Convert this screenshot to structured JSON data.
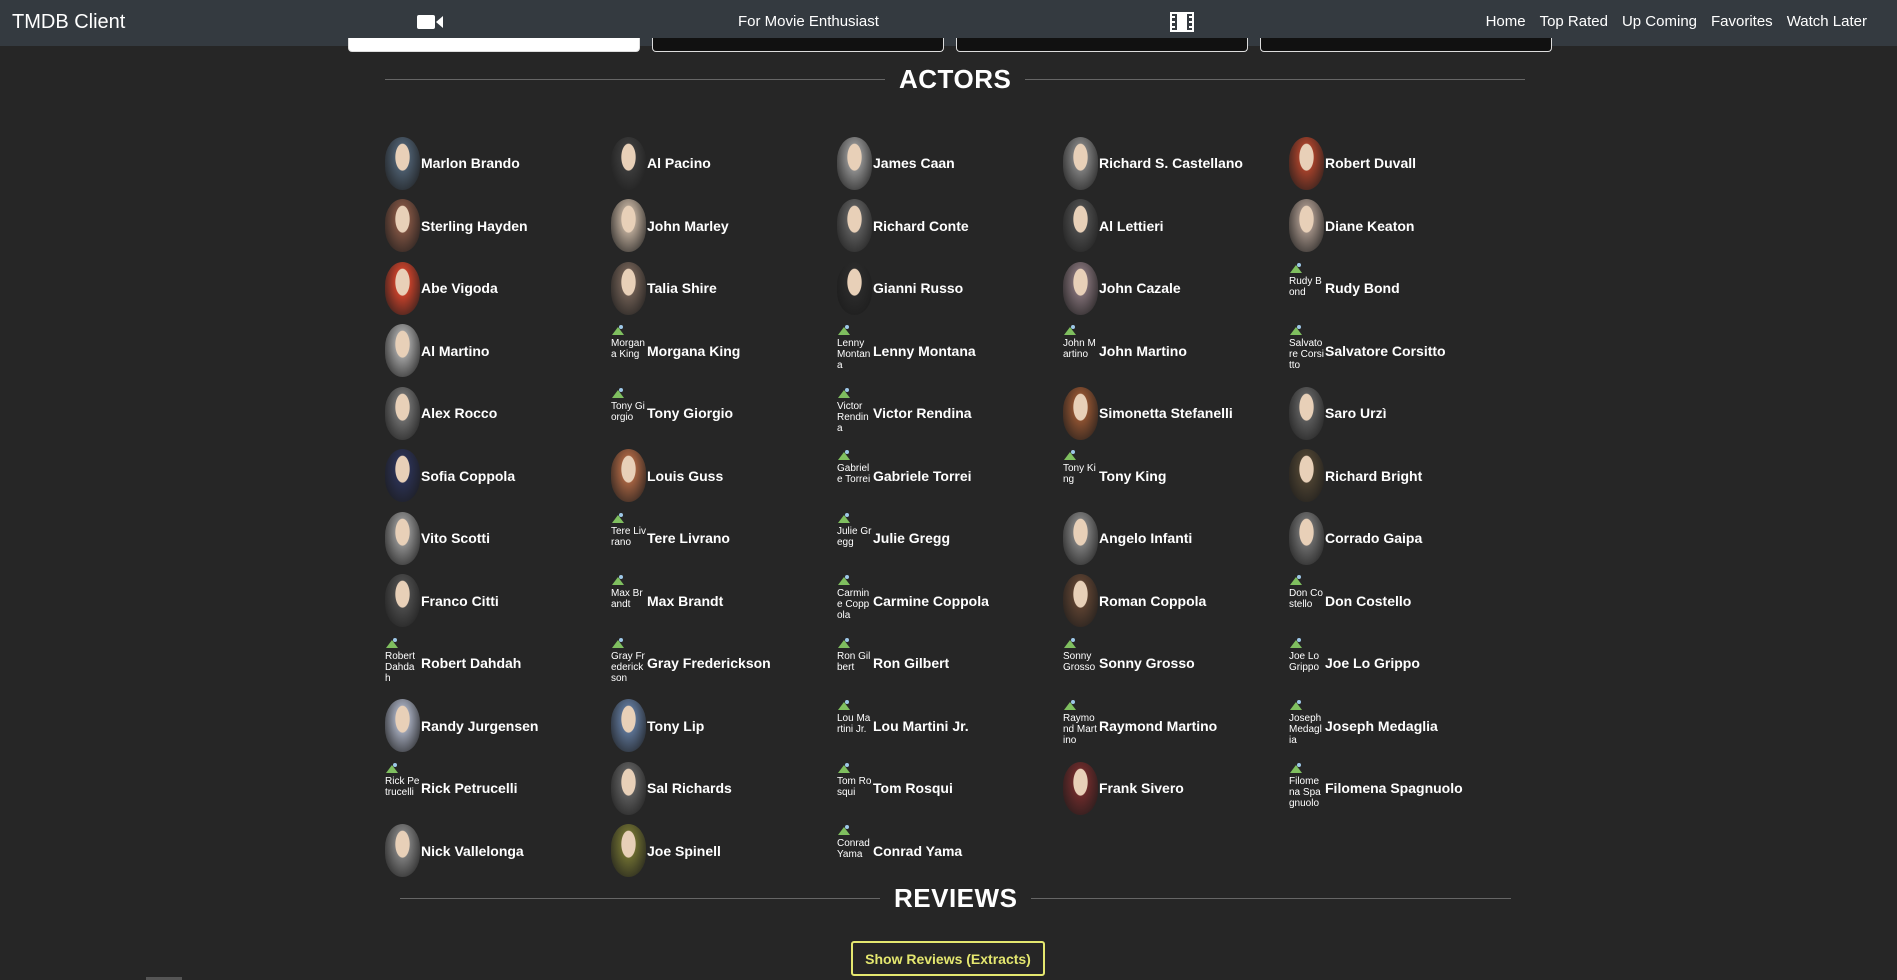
{
  "navbar": {
    "brand": "TMDB Client",
    "tagline": "For Movie Enthusiast",
    "camera_icon": "video-camera-icon",
    "film_icon": "film-icon",
    "links": [
      "Home",
      "Top Rated",
      "Up Coming",
      "Favorites",
      "Watch Later"
    ]
  },
  "actors_section": {
    "title": "ACTORS",
    "actors": [
      {
        "name": "Marlon Brando",
        "photo": true,
        "color": "#4a5a6a"
      },
      {
        "name": "Al Pacino",
        "photo": true,
        "color": "#3a3a3a"
      },
      {
        "name": "James Caan",
        "photo": true,
        "color": "#8a8a8a"
      },
      {
        "name": "Richard S. Castellano",
        "photo": true,
        "color": "#7a7a7a"
      },
      {
        "name": "Robert Duvall",
        "photo": true,
        "color": "#a0402a"
      },
      {
        "name": "Sterling Hayden",
        "photo": true,
        "color": "#7a5040"
      },
      {
        "name": "John Marley",
        "photo": true,
        "color": "#b0a090"
      },
      {
        "name": "Richard Conte",
        "photo": true,
        "color": "#5a5a5a"
      },
      {
        "name": "Al Lettieri",
        "photo": true,
        "color": "#4a4a4a"
      },
      {
        "name": "Diane Keaton",
        "photo": true,
        "color": "#9a8a80"
      },
      {
        "name": "Abe Vigoda",
        "photo": true,
        "color": "#c0402a"
      },
      {
        "name": "Talia Shire",
        "photo": true,
        "color": "#6a5a50"
      },
      {
        "name": "Gianni Russo",
        "photo": true,
        "color": "#2a2a2a"
      },
      {
        "name": "John Cazale",
        "photo": true,
        "color": "#7a6a70"
      },
      {
        "name": "Rudy Bond",
        "photo": false,
        "alt": "Rudy Bond"
      },
      {
        "name": "Al Martino",
        "photo": true,
        "color": "#9a9a9a"
      },
      {
        "name": "Morgana King",
        "photo": false,
        "alt": "Morgana King"
      },
      {
        "name": "Lenny Montana",
        "photo": false,
        "alt": "Lenny Montana"
      },
      {
        "name": "John Martino",
        "photo": false,
        "alt": "John Martino"
      },
      {
        "name": "Salvatore Corsitto",
        "photo": false,
        "alt": "Salvatore Corsitto"
      },
      {
        "name": "Alex Rocco",
        "photo": true,
        "color": "#6a6a6a"
      },
      {
        "name": "Tony Giorgio",
        "photo": false,
        "alt": "Tony Giorgio"
      },
      {
        "name": "Victor Rendina",
        "photo": false,
        "alt": "Victor Rendina"
      },
      {
        "name": "Simonetta Stefanelli",
        "photo": true,
        "color": "#8a5030"
      },
      {
        "name": "Saro Urzì",
        "photo": true,
        "color": "#5a5a5a"
      },
      {
        "name": "Sofia Coppola",
        "photo": true,
        "color": "#2a3050"
      },
      {
        "name": "Louis Guss",
        "photo": true,
        "color": "#a06040"
      },
      {
        "name": "Gabriele Torrei",
        "photo": false,
        "alt": "Gabriele Torrei"
      },
      {
        "name": "Tony King",
        "photo": false,
        "alt": "Tony King"
      },
      {
        "name": "Richard Bright",
        "photo": true,
        "color": "#4a4030"
      },
      {
        "name": "Vito Scotti",
        "photo": true,
        "color": "#8a8a8a"
      },
      {
        "name": "Tere Livrano",
        "photo": false,
        "alt": "Tere Livrano"
      },
      {
        "name": "Julie Gregg",
        "photo": false,
        "alt": "Julie Gregg"
      },
      {
        "name": "Angelo Infanti",
        "photo": true,
        "color": "#7a7a7a"
      },
      {
        "name": "Corrado Gaipa",
        "photo": true,
        "color": "#6a6a6a"
      },
      {
        "name": "Franco Citti",
        "photo": true,
        "color": "#4a4a4a"
      },
      {
        "name": "Max Brandt",
        "photo": false,
        "alt": "Max Brandt"
      },
      {
        "name": "Carmine Coppola",
        "photo": false,
        "alt": "Carmine Coppola"
      },
      {
        "name": "Roman Coppola",
        "photo": true,
        "color": "#5a4030"
      },
      {
        "name": "Don Costello",
        "photo": false,
        "alt": "Don Costello"
      },
      {
        "name": "Robert Dahdah",
        "photo": false,
        "alt": "Robert Dahdah"
      },
      {
        "name": "Gray Frederickson",
        "photo": false,
        "alt": "Gray Frederickson"
      },
      {
        "name": "Ron Gilbert",
        "photo": false,
        "alt": "Ron Gilbert"
      },
      {
        "name": "Sonny Grosso",
        "photo": false,
        "alt": "Sonny Grosso"
      },
      {
        "name": "Joe Lo Grippo",
        "photo": false,
        "alt": "Joe Lo Grippo"
      },
      {
        "name": "Randy Jurgensen",
        "photo": true,
        "color": "#9aa0b0"
      },
      {
        "name": "Tony Lip",
        "photo": true,
        "color": "#5a7090"
      },
      {
        "name": "Lou Martini Jr.",
        "photo": false,
        "alt": "Lou Martini Jr."
      },
      {
        "name": "Raymond Martino",
        "photo": false,
        "alt": "Raymond Martino"
      },
      {
        "name": "Joseph Medaglia",
        "photo": false,
        "alt": "Joseph Medaglia"
      },
      {
        "name": "Rick Petrucelli",
        "photo": false,
        "alt": "Rick Petrucelli"
      },
      {
        "name": "Sal Richards",
        "photo": true,
        "color": "#5a5a5a"
      },
      {
        "name": "Tom Rosqui",
        "photo": false,
        "alt": "Tom Rosqui"
      },
      {
        "name": "Frank Sivero",
        "photo": true,
        "color": "#6a2a2a"
      },
      {
        "name": "Filomena Spagnuolo",
        "photo": false,
        "alt": "Filomena Spagnuolo"
      },
      {
        "name": "Nick Vallelonga",
        "photo": true,
        "color": "#7a7a7a"
      },
      {
        "name": "Joe Spinell",
        "photo": true,
        "color": "#6a6a30"
      },
      {
        "name": "Conrad Yama",
        "photo": false,
        "alt": "Conrad Yama"
      }
    ]
  },
  "reviews_section": {
    "title": "REVIEWS",
    "button_label": "Show Reviews (Extracts)",
    "accent_color": "#e4e76f"
  }
}
